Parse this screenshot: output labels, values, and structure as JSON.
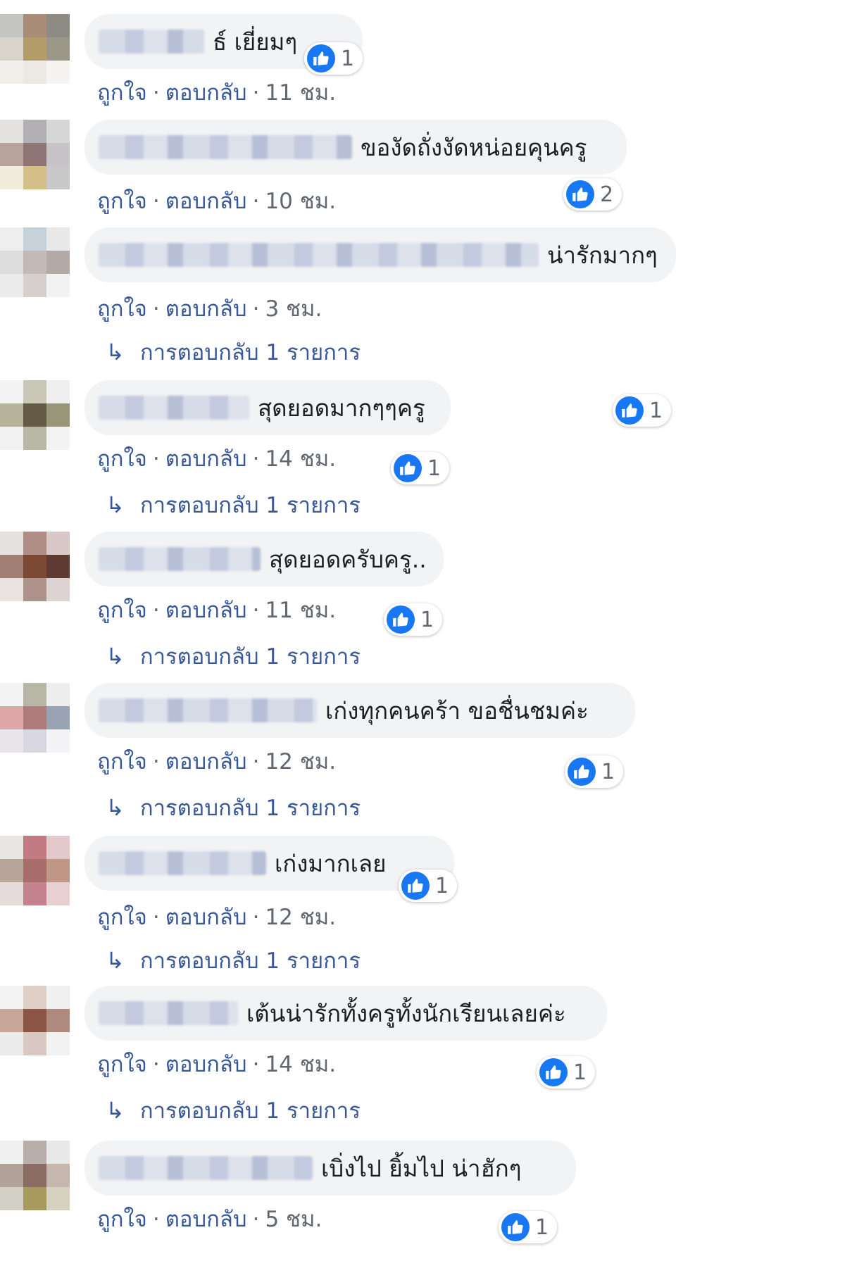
{
  "actions": {
    "like": "ถูกใจ",
    "reply": "ตอบกลับ",
    "separator": "·"
  },
  "colors": {
    "like_blue": "#1877f2",
    "link": "#385898",
    "meta_gray": "#606770",
    "bubble": "#f2f3f5"
  },
  "comments": [
    {
      "text": "ธ์ เยี่ยมๆ",
      "likes": "1",
      "time": "11 ชม.",
      "replies": ""
    },
    {
      "text": "ของัดถั่งงัดหน่อยคุนครู",
      "likes": "2",
      "time": "10 ชม.",
      "replies": ""
    },
    {
      "text": "น่ารักมากๆ",
      "likes": "1",
      "time": "3 ชม.",
      "replies": "การตอบกลับ 1 รายการ"
    },
    {
      "text": "สุดยอดมากๆๆครู",
      "likes": "1",
      "time": "14 ชม.",
      "replies": "การตอบกลับ 1 รายการ"
    },
    {
      "text": "สุดยอดครับครู..",
      "likes": "1",
      "time": "11 ชม.",
      "replies": "การตอบกลับ 1 รายการ"
    },
    {
      "text": "เก่งทุกคนคร้า ขอชื่นชมค่ะ",
      "likes": "1",
      "time": "12 ชม.",
      "replies": "การตอบกลับ 1 รายการ"
    },
    {
      "text": "เก่งมากเลย",
      "likes": "1",
      "time": "12 ชม.",
      "replies": "การตอบกลับ 1 รายการ"
    },
    {
      "text": "เต้นน่ารักทั้งครูทั้งนักเรียนเลยค่ะ",
      "likes": "1",
      "time": "14 ชม.",
      "replies": "การตอบกลับ 1 รายการ"
    },
    {
      "text": "เบิ่งไป ยิ้มไป น่าฮักๆ",
      "likes": "1",
      "time": "5 ชม.",
      "replies": ""
    }
  ]
}
